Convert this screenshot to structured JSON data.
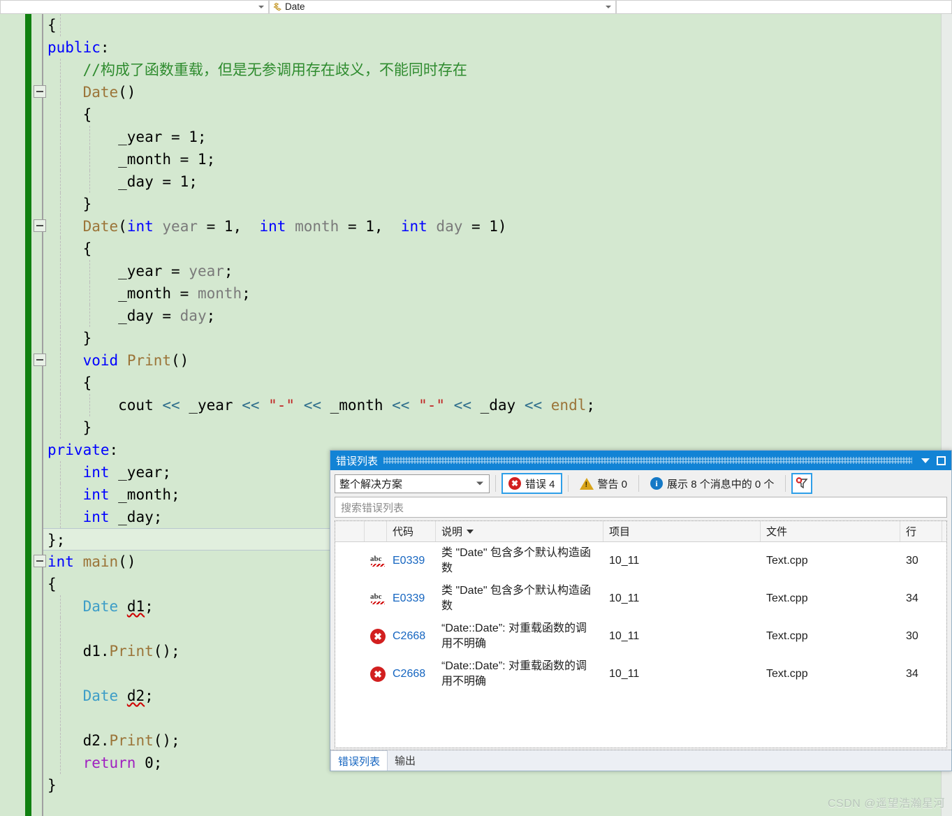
{
  "navbar": {
    "left_value": "",
    "type_value": "Date",
    "member_value": "",
    "type_icon": "class-icon",
    "caret_icon": "chevron-down-icon"
  },
  "editor": {
    "language": "cpp",
    "lines": [
      {
        "indent": 1,
        "tokens": [
          {
            "t": "{",
            "c": "pl"
          }
        ]
      },
      {
        "indent": 0,
        "tokens": [
          {
            "t": "public",
            "c": "k"
          },
          {
            "t": ":",
            "c": "pl"
          }
        ]
      },
      {
        "indent": 1,
        "tokens": [
          {
            "t": "    //构成了函数重载，但是无参调用存在歧义，不能同时存在",
            "c": "cm"
          }
        ]
      },
      {
        "indent": 1,
        "fold": true,
        "tokens": [
          {
            "t": "    ",
            "c": "pl"
          },
          {
            "t": "Date",
            "c": "fn"
          },
          {
            "t": "()",
            "c": "pl"
          }
        ]
      },
      {
        "indent": 1,
        "tokens": [
          {
            "t": "    {",
            "c": "pl"
          }
        ]
      },
      {
        "indent": 2,
        "tokens": [
          {
            "t": "        _year = 1;",
            "c": "pl"
          }
        ]
      },
      {
        "indent": 2,
        "tokens": [
          {
            "t": "        _month = 1;",
            "c": "pl"
          }
        ]
      },
      {
        "indent": 2,
        "tokens": [
          {
            "t": "        _day = 1;",
            "c": "pl"
          }
        ]
      },
      {
        "indent": 1,
        "tokens": [
          {
            "t": "    }",
            "c": "pl"
          }
        ]
      },
      {
        "indent": 1,
        "fold": true,
        "tokens": [
          {
            "t": "    ",
            "c": "pl"
          },
          {
            "t": "Date",
            "c": "fn"
          },
          {
            "t": "(",
            "c": "pl"
          },
          {
            "t": "int",
            "c": "k"
          },
          {
            "t": " ",
            "c": "pl"
          },
          {
            "t": "year",
            "c": "pm"
          },
          {
            "t": " = 1,  ",
            "c": "pl"
          },
          {
            "t": "int",
            "c": "k"
          },
          {
            "t": " ",
            "c": "pl"
          },
          {
            "t": "month",
            "c": "pm"
          },
          {
            "t": " = 1,  ",
            "c": "pl"
          },
          {
            "t": "int",
            "c": "k"
          },
          {
            "t": " ",
            "c": "pl"
          },
          {
            "t": "day",
            "c": "pm"
          },
          {
            "t": " = 1)",
            "c": "pl"
          }
        ]
      },
      {
        "indent": 1,
        "tokens": [
          {
            "t": "    {",
            "c": "pl"
          }
        ]
      },
      {
        "indent": 2,
        "tokens": [
          {
            "t": "        _year = ",
            "c": "pl"
          },
          {
            "t": "year",
            "c": "pm"
          },
          {
            "t": ";",
            "c": "pl"
          }
        ]
      },
      {
        "indent": 2,
        "tokens": [
          {
            "t": "        _month = ",
            "c": "pl"
          },
          {
            "t": "month",
            "c": "pm"
          },
          {
            "t": ";",
            "c": "pl"
          }
        ]
      },
      {
        "indent": 2,
        "tokens": [
          {
            "t": "        _day = ",
            "c": "pl"
          },
          {
            "t": "day",
            "c": "pm"
          },
          {
            "t": ";",
            "c": "pl"
          }
        ]
      },
      {
        "indent": 1,
        "tokens": [
          {
            "t": "    }",
            "c": "pl"
          }
        ]
      },
      {
        "indent": 1,
        "fold": true,
        "tokens": [
          {
            "t": "    ",
            "c": "pl"
          },
          {
            "t": "void",
            "c": "k"
          },
          {
            "t": " ",
            "c": "pl"
          },
          {
            "t": "Print",
            "c": "fn"
          },
          {
            "t": "()",
            "c": "pl"
          }
        ]
      },
      {
        "indent": 1,
        "tokens": [
          {
            "t": "    {",
            "c": "pl"
          }
        ]
      },
      {
        "indent": 2,
        "tokens": [
          {
            "t": "        cout ",
            "c": "pl"
          },
          {
            "t": "<<",
            "c": "op"
          },
          {
            "t": " _year ",
            "c": "pl"
          },
          {
            "t": "<<",
            "c": "op"
          },
          {
            "t": " \"-\" ",
            "c": "st"
          },
          {
            "t": "<<",
            "c": "op"
          },
          {
            "t": " _month ",
            "c": "pl"
          },
          {
            "t": "<<",
            "c": "op"
          },
          {
            "t": " \"-\" ",
            "c": "st"
          },
          {
            "t": "<<",
            "c": "op"
          },
          {
            "t": " _day ",
            "c": "pl"
          },
          {
            "t": "<<",
            "c": "op"
          },
          {
            "t": " ",
            "c": "pl"
          },
          {
            "t": "endl",
            "c": "fn"
          },
          {
            "t": ";",
            "c": "pl"
          }
        ]
      },
      {
        "indent": 1,
        "tokens": [
          {
            "t": "    }",
            "c": "pl"
          }
        ]
      },
      {
        "indent": 0,
        "tokens": [
          {
            "t": "private",
            "c": "k"
          },
          {
            "t": ":",
            "c": "pl"
          }
        ]
      },
      {
        "indent": 1,
        "tokens": [
          {
            "t": "    ",
            "c": "pl"
          },
          {
            "t": "int",
            "c": "k"
          },
          {
            "t": " _year;",
            "c": "pl"
          }
        ]
      },
      {
        "indent": 1,
        "tokens": [
          {
            "t": "    ",
            "c": "pl"
          },
          {
            "t": "int",
            "c": "k"
          },
          {
            "t": " _month;",
            "c": "pl"
          }
        ]
      },
      {
        "indent": 1,
        "tokens": [
          {
            "t": "    ",
            "c": "pl"
          },
          {
            "t": "int",
            "c": "k"
          },
          {
            "t": " _day;",
            "c": "pl"
          }
        ]
      },
      {
        "indent": 0,
        "current": true,
        "tokens": [
          {
            "t": "};",
            "c": "pl"
          }
        ]
      },
      {
        "indent": 0,
        "fold": true,
        "tokens": [
          {
            "t": "int",
            "c": "k"
          },
          {
            "t": " ",
            "c": "pl"
          },
          {
            "t": "main",
            "c": "fn"
          },
          {
            "t": "()",
            "c": "pl"
          }
        ]
      },
      {
        "indent": 0,
        "tokens": [
          {
            "t": "{",
            "c": "pl"
          }
        ]
      },
      {
        "indent": 1,
        "tokens": [
          {
            "t": "    ",
            "c": "pl"
          },
          {
            "t": "Date",
            "c": "ty"
          },
          {
            "t": " ",
            "c": "pl"
          },
          {
            "t": "d1",
            "c": "pl sq"
          },
          {
            "t": ";",
            "c": "pl"
          }
        ]
      },
      {
        "indent": 1,
        "tokens": [
          {
            "t": "",
            "c": "pl"
          }
        ]
      },
      {
        "indent": 1,
        "tokens": [
          {
            "t": "    d1.",
            "c": "pl"
          },
          {
            "t": "Print",
            "c": "fn"
          },
          {
            "t": "();",
            "c": "pl"
          }
        ]
      },
      {
        "indent": 1,
        "tokens": [
          {
            "t": "",
            "c": "pl"
          }
        ]
      },
      {
        "indent": 1,
        "tokens": [
          {
            "t": "    ",
            "c": "pl"
          },
          {
            "t": "Date",
            "c": "ty"
          },
          {
            "t": " ",
            "c": "pl"
          },
          {
            "t": "d2",
            "c": "pl sq"
          },
          {
            "t": ";",
            "c": "pl"
          }
        ]
      },
      {
        "indent": 1,
        "tokens": [
          {
            "t": "",
            "c": "pl"
          }
        ]
      },
      {
        "indent": 1,
        "tokens": [
          {
            "t": "    d2.",
            "c": "pl"
          },
          {
            "t": "Print",
            "c": "fn"
          },
          {
            "t": "();",
            "c": "pl"
          }
        ]
      },
      {
        "indent": 1,
        "tokens": [
          {
            "t": "    ",
            "c": "pl"
          },
          {
            "t": "return",
            "c": "kp"
          },
          {
            "t": " 0;",
            "c": "pl"
          }
        ]
      },
      {
        "indent": 0,
        "tokens": [
          {
            "t": "}",
            "c": "pl"
          }
        ]
      }
    ]
  },
  "error_panel": {
    "title": "错误列表",
    "title_caret_icon": "chevron-down-icon",
    "title_pin_icon": "pin-icon",
    "scope": {
      "selected": "整个解决方案",
      "caret_icon": "chevron-down-icon"
    },
    "errors_label": "错误 4",
    "errors_count": 4,
    "warnings_label": "警告 0",
    "warnings_count": 0,
    "messages_label": "展示 8 个消息中的 0 个",
    "error_icon": "error-circle-icon",
    "warning_icon": "warning-triangle-icon",
    "info_icon": "info-circle-icon",
    "filter_icon": "clear-filter-icon",
    "search_placeholder": "搜索错误列表",
    "search_value": "",
    "columns": [
      "",
      "",
      "代码",
      "说明",
      "项目",
      "文件",
      "行"
    ],
    "sort_column": "说明",
    "sort_caret_icon": "caret-down-icon",
    "rows": [
      {
        "icon": "intellisense-abc-icon",
        "code": "E0339",
        "description": "类 \"Date\" 包含多个默认构造函数",
        "project": "10_11",
        "file": "Text.cpp",
        "line": "30"
      },
      {
        "icon": "intellisense-abc-icon",
        "code": "E0339",
        "description": "类 \"Date\" 包含多个默认构造函数",
        "project": "10_11",
        "file": "Text.cpp",
        "line": "34"
      },
      {
        "icon": "error-circle-icon",
        "code": "C2668",
        "description": "“Date::Date”: 对重载函数的调用不明确",
        "project": "10_11",
        "file": "Text.cpp",
        "line": "30"
      },
      {
        "icon": "error-circle-icon",
        "code": "C2668",
        "description": "“Date::Date”: 对重载函数的调用不明确",
        "project": "10_11",
        "file": "Text.cpp",
        "line": "34"
      }
    ],
    "tabs": [
      {
        "label": "错误列表",
        "active": true
      },
      {
        "label": "输出",
        "active": false
      }
    ]
  },
  "watermark": "CSDN @遥望浩瀚星河",
  "colors": {
    "editor_background": "#d4e8d0",
    "accent_blue": "#1283d5",
    "error_red": "#d21f1f",
    "warning_yellow": "#d9a41a",
    "info_blue": "#1579c6",
    "keyword_blue": "#0000ff",
    "comment_green": "#2e8b2e",
    "string_red": "#c02020",
    "function_brown": "#9b7438",
    "type_cyan": "#3d9dc7",
    "change_bar_green": "#108010"
  }
}
